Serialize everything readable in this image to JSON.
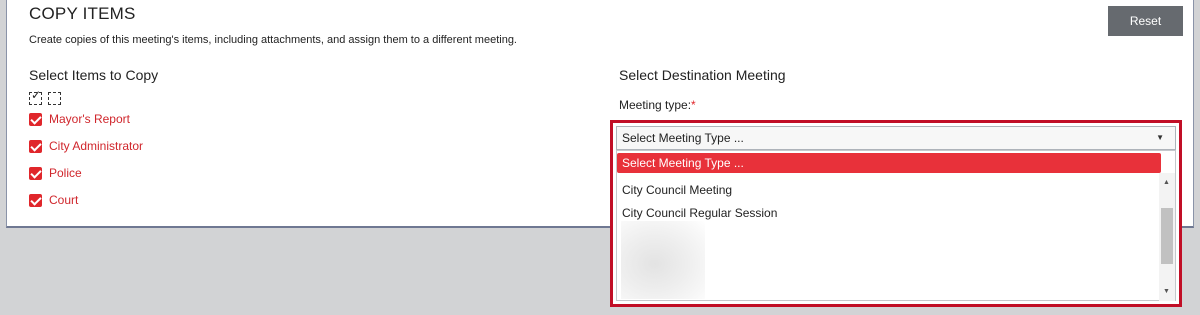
{
  "header": {
    "title": "COPY ITEMS",
    "description": "Create copies of this meeting's items, including attachments, and assign them to a different meeting.",
    "reset_label": "Reset"
  },
  "left": {
    "heading": "Select Items to Copy",
    "items": [
      {
        "label": "Mayor's Report",
        "checked": true
      },
      {
        "label": "City Administrator",
        "checked": true
      },
      {
        "label": "Police",
        "checked": true
      },
      {
        "label": "Court",
        "checked": true
      }
    ]
  },
  "right": {
    "heading": "Select Destination Meeting",
    "meeting_type_label": "Meeting type:",
    "required_mark": "*",
    "select_value": "Select Meeting Type ...",
    "options": [
      {
        "label": "Select Meeting Type ...",
        "selected": true
      },
      {
        "label": "City Council Meeting",
        "selected": false
      },
      {
        "label": "City Council Regular Session",
        "selected": false
      }
    ]
  },
  "colors": {
    "accent_red": "#e8313a",
    "frame_red": "#c10e26",
    "reset_button": "#666a6f"
  },
  "icons": [
    "checkbox-checked-icon",
    "dropdown-caret-icon",
    "scroll-up-icon",
    "scroll-down-icon"
  ]
}
